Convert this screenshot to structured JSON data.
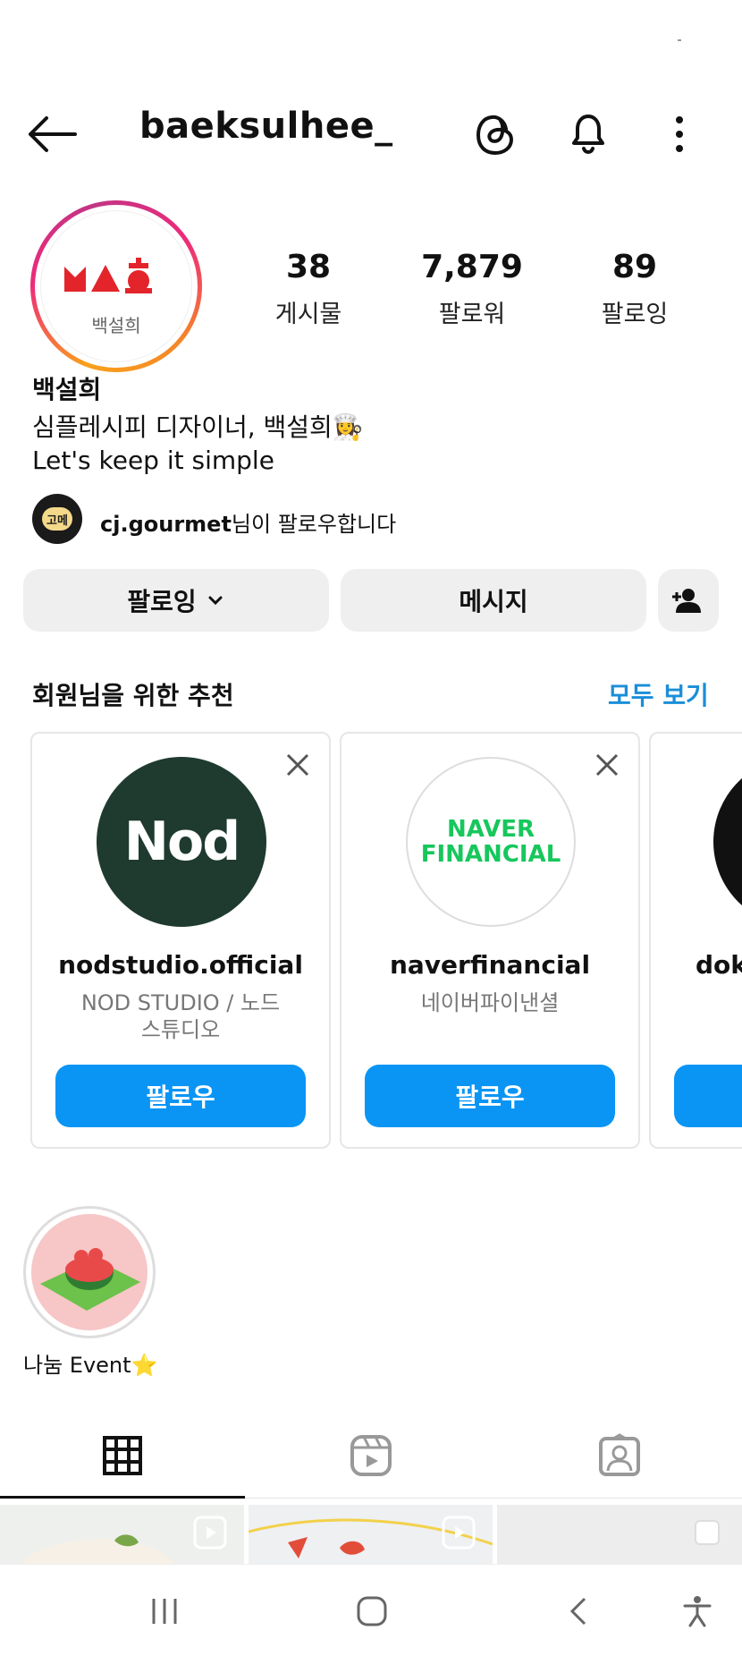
{
  "header": {
    "username": "baeksulhee_"
  },
  "profile": {
    "avatar_text": "백설희",
    "stats": {
      "posts": {
        "value": "38",
        "label": "게시물"
      },
      "followers": {
        "value": "7,879",
        "label": "팔로워"
      },
      "following": {
        "value": "89",
        "label": "팔로잉"
      }
    },
    "display_name": "백설희",
    "bio_line1": "심플레시피 디자이너, 백설희👩‍🍳",
    "bio_line2": "Let's keep it simple",
    "mutual": {
      "username": "cj.gourmet",
      "suffix": "님이 팔로우합니다",
      "avatar_text": "고메"
    }
  },
  "actions": {
    "following_label": "팔로잉",
    "message_label": "메시지"
  },
  "suggestions": {
    "title": "회원님을 위한 추천",
    "see_all": "모두 보기",
    "cards": [
      {
        "username": "nodstudio.official",
        "subtitle": "NOD STUDIO / 노드 스튜디오",
        "logo_text": "Nod",
        "follow_label": "팔로우"
      },
      {
        "username": "naverfinancial",
        "subtitle": "네이버파이낸셜",
        "logo_line1": "NAVER",
        "logo_line2": "FINANCIAL",
        "follow_label": "팔로우"
      },
      {
        "username": "doke",
        "subtitle": "",
        "follow_label": ""
      }
    ]
  },
  "highlight": {
    "label": "나눔 Event⭐"
  },
  "colors": {
    "accent": "#0a95f5",
    "link": "#1a8ed8",
    "button_bg": "#efefef"
  }
}
